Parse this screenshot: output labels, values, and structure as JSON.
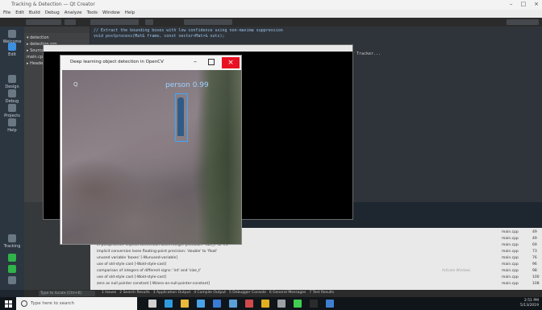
{
  "titlebar": {
    "title": "Tracking & Detection — Qt Creator"
  },
  "menu": {
    "items": [
      "File",
      "Edit",
      "Build",
      "Debug",
      "Analyze",
      "Tools",
      "Window",
      "Help"
    ]
  },
  "modes": [
    {
      "label": "Welcome",
      "icon": "grid-icon",
      "color": "#6a7884"
    },
    {
      "label": "Edit",
      "icon": "document-icon",
      "color": "#3d8fe0"
    },
    {
      "label": "Design",
      "icon": "pen-icon",
      "color": "#6a7884"
    },
    {
      "label": "Debug",
      "icon": "bug-icon",
      "color": "#6a7884"
    },
    {
      "label": "Projects",
      "icon": "wrench-icon",
      "color": "#6a7884"
    },
    {
      "label": "Help",
      "icon": "question-icon",
      "color": "#6a7884"
    }
  ],
  "mode_bottom": [
    {
      "label": "Tracking",
      "icon": "monitor-icon",
      "color": "#6a7884"
    },
    {
      "label": "Run",
      "icon": "run-icon",
      "color": "#2fb34a"
    },
    {
      "label": "Debug run",
      "icon": "debug-run-icon",
      "color": "#2fb34a"
    },
    {
      "label": "Build",
      "icon": "hammer-icon",
      "color": "#6a7884"
    }
  ],
  "project_tree": [
    "▾ detection",
    "  ▸ detection.pro",
    "  ▸ Sources",
    "    main.cpp",
    "  ▸ Headers"
  ],
  "editor": {
    "lines": [
      "// Extract the bounding boxes with low confidence using non-maxima suppression",
      "void postprocess(Mat& frame, const vector<Mat>& outs);"
    ],
    "status_note": "Tracker..."
  },
  "image_window": {
    "title": "Deep learning object detection in OpenCV",
    "close_label": "×",
    "min_label": "–",
    "detection_label": "person 0.99",
    "logo_text": "Q"
  },
  "issues": [
    {
      "text": "warning: unused parameter 'argc' [-Wunused-parameter]",
      "file": "main.cpp",
      "line": "49"
    },
    {
      "text": "warning: unused parameter 'argv' [-Wunused-parameter]",
      "file": "main.cpp",
      "line": "49"
    },
    {
      "text": "in postprocess: implicit conversion loses integer precision: 'size_t' to 'int'",
      "file": "main.cpp",
      "line": "69"
    },
    {
      "text": "implicit conversion loses floating-point precision: 'double' to 'float'",
      "file": "main.cpp",
      "line": "73"
    },
    {
      "text": "unused variable 'boxes' [-Wunused-variable]",
      "file": "main.cpp",
      "line": "76"
    },
    {
      "text": "use of old-style cast [-Wold-style-cast]",
      "file": "main.cpp",
      "line": "96"
    },
    {
      "text": "comparison of integers of different signs: 'int' and 'size_t'",
      "file": "main.cpp",
      "line": "98"
    },
    {
      "text": "use of old-style cast [-Wold-style-cast]",
      "file": "main.cpp",
      "line": "100"
    },
    {
      "text": "zero as null pointer constant [-Wzero-as-null-pointer-constant]",
      "file": "main.cpp",
      "line": "108"
    }
  ],
  "watermark": "Activate Windows",
  "output_tabs": {
    "search_placeholder": "Type to locate (Ctrl+K)",
    "tabs": [
      "1 Issues",
      "2 Search Results",
      "3 Application Output",
      "4 Compile Output",
      "5 Debugger Console",
      "6 General Messages",
      "7 Test Results"
    ]
  },
  "taskbar": {
    "search_placeholder": "Type here to search",
    "apps": [
      {
        "name": "task-view-icon",
        "color": "#d0d0d0"
      },
      {
        "name": "edge-icon",
        "color": "#2f9bde"
      },
      {
        "name": "file-explorer-icon",
        "color": "#e8b93a"
      },
      {
        "name": "store-icon",
        "color": "#4aa3e6"
      },
      {
        "name": "mail-icon",
        "color": "#3a7bd5"
      },
      {
        "name": "photos-icon",
        "color": "#5aa0d8"
      },
      {
        "name": "media-icon",
        "color": "#d04a4a"
      },
      {
        "name": "chrome-icon",
        "color": "#e0b020"
      },
      {
        "name": "settings-icon",
        "color": "#9aa0a6"
      },
      {
        "name": "qt-icon",
        "color": "#41cd52"
      },
      {
        "name": "terminal-icon",
        "color": "#2b2b2b"
      },
      {
        "name": "app-icon",
        "color": "#3f7fd0"
      }
    ],
    "time": "2:51 PM",
    "date": "5/13/2019"
  },
  "colors": {
    "accent": "#3ea6ff",
    "close": "#e81123",
    "taskbar": "#10151a"
  }
}
